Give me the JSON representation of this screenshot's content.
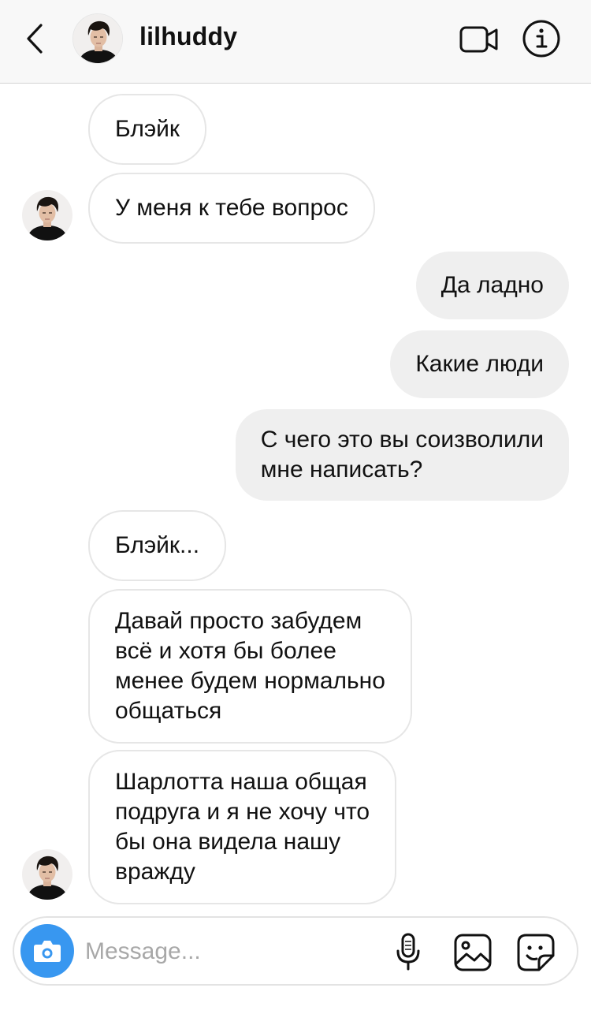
{
  "header": {
    "username": "lilhuddy",
    "back_icon": "chevron-left-icon",
    "video_icon": "video-call-icon",
    "info_icon": "info-icon"
  },
  "messages": [
    {
      "direction": "in",
      "text": "Блэйк"
    },
    {
      "direction": "in",
      "text": "У меня к тебе вопрос"
    },
    {
      "direction": "out",
      "text": "Да ладно"
    },
    {
      "direction": "out",
      "text": "Какие люди"
    },
    {
      "direction": "out",
      "text": "С чего это вы соизволили\nмне написать?"
    },
    {
      "direction": "in",
      "text": "Блэйк..."
    },
    {
      "direction": "in",
      "text": "Давай просто забудем\nвсё и хотя бы более\nменее будем нормально\nобщаться"
    },
    {
      "direction": "in",
      "text": "Шарлотта наша общая\nподруга и я не хочу что\nбы она видела нашу\nвражду"
    }
  ],
  "composer": {
    "placeholder": "Message...",
    "value": "",
    "camera_icon": "camera-icon",
    "mic_icon": "microphone-icon",
    "gallery_icon": "gallery-icon",
    "sticker_icon": "sticker-icon"
  },
  "colors": {
    "accent": "#3897f0",
    "outgoing_bubble": "#efefef",
    "incoming_border": "#e6e6e6",
    "header_bg": "#f8f8f8"
  }
}
